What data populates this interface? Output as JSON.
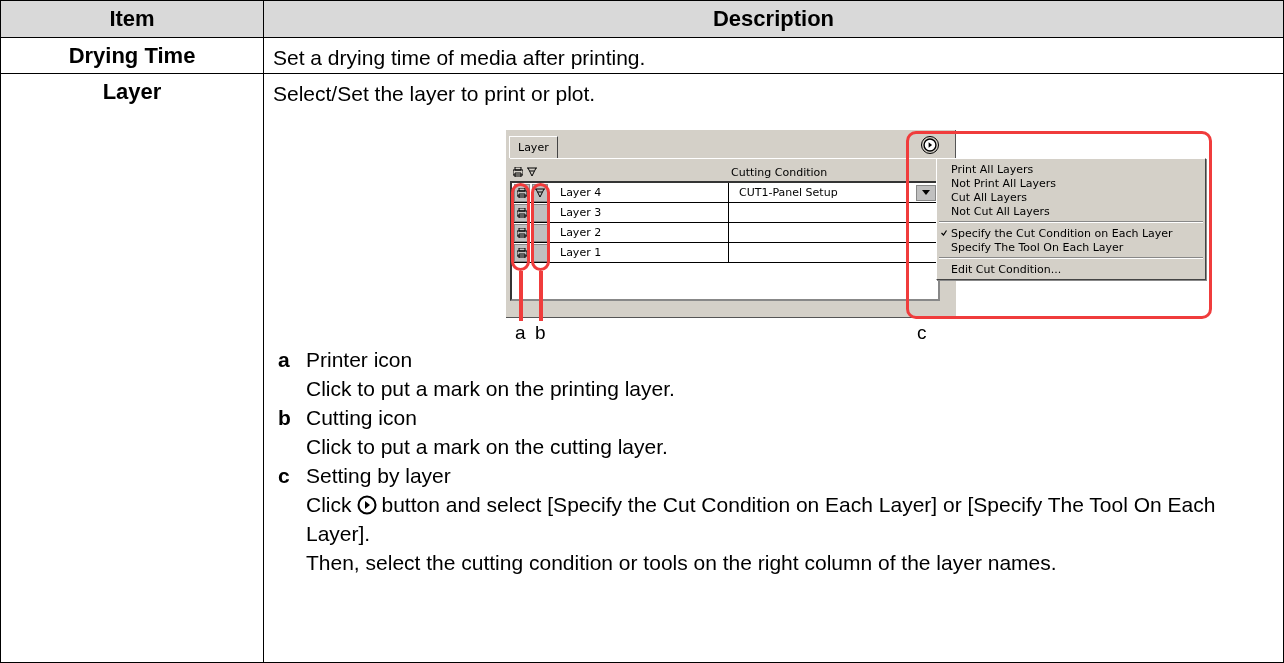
{
  "table": {
    "columns": [
      "Item",
      "Description"
    ],
    "rows": [
      {
        "item": "Drying Time",
        "description": "Set a drying time of media after printing."
      },
      {
        "item": "Layer",
        "description": "Select/Set the layer to print or plot.",
        "screenshot": {
          "tab": "Layer",
          "column_header": "Cutting Condition",
          "layers": [
            {
              "name": "Layer 4",
              "print": true,
              "cut": true,
              "condition": "CUT1-Panel Setup"
            },
            {
              "name": "Layer 3",
              "print": true,
              "cut": false
            },
            {
              "name": "Layer 2",
              "print": true,
              "cut": false
            },
            {
              "name": "Layer 1",
              "print": true,
              "cut": false
            }
          ],
          "menu": [
            [
              {
                "label": "Print All Layers",
                "checked": false
              },
              {
                "label": "Not Print All Layers",
                "checked": false
              },
              {
                "label": "Cut All Layers",
                "checked": false
              },
              {
                "label": "Not Cut All Layers",
                "checked": false
              }
            ],
            [
              {
                "label": "Specify the Cut Condition on Each Layer",
                "checked": true
              },
              {
                "label": "Specify The Tool On Each Layer",
                "checked": false
              }
            ],
            [
              {
                "label": "Edit Cut Condition...",
                "checked": false
              }
            ]
          ],
          "callouts": [
            "a",
            "b",
            "c"
          ]
        },
        "notes": [
          {
            "key": "a",
            "title": "Printer icon",
            "lines": [
              "Click to put a mark on the printing layer."
            ]
          },
          {
            "key": "b",
            "title": "Cutting icon",
            "lines": [
              "Click to put a mark on the cutting layer."
            ]
          },
          {
            "key": "c",
            "title": "Setting by layer",
            "icon_line": {
              "before": "Click",
              "after": "button and select [Specify the Cut Condition on Each Layer] or [Specify The Tool On Each Layer]."
            },
            "lines": [
              "Then, select the cutting condition or tools on the right column of the layer names."
            ]
          }
        ]
      }
    ]
  }
}
